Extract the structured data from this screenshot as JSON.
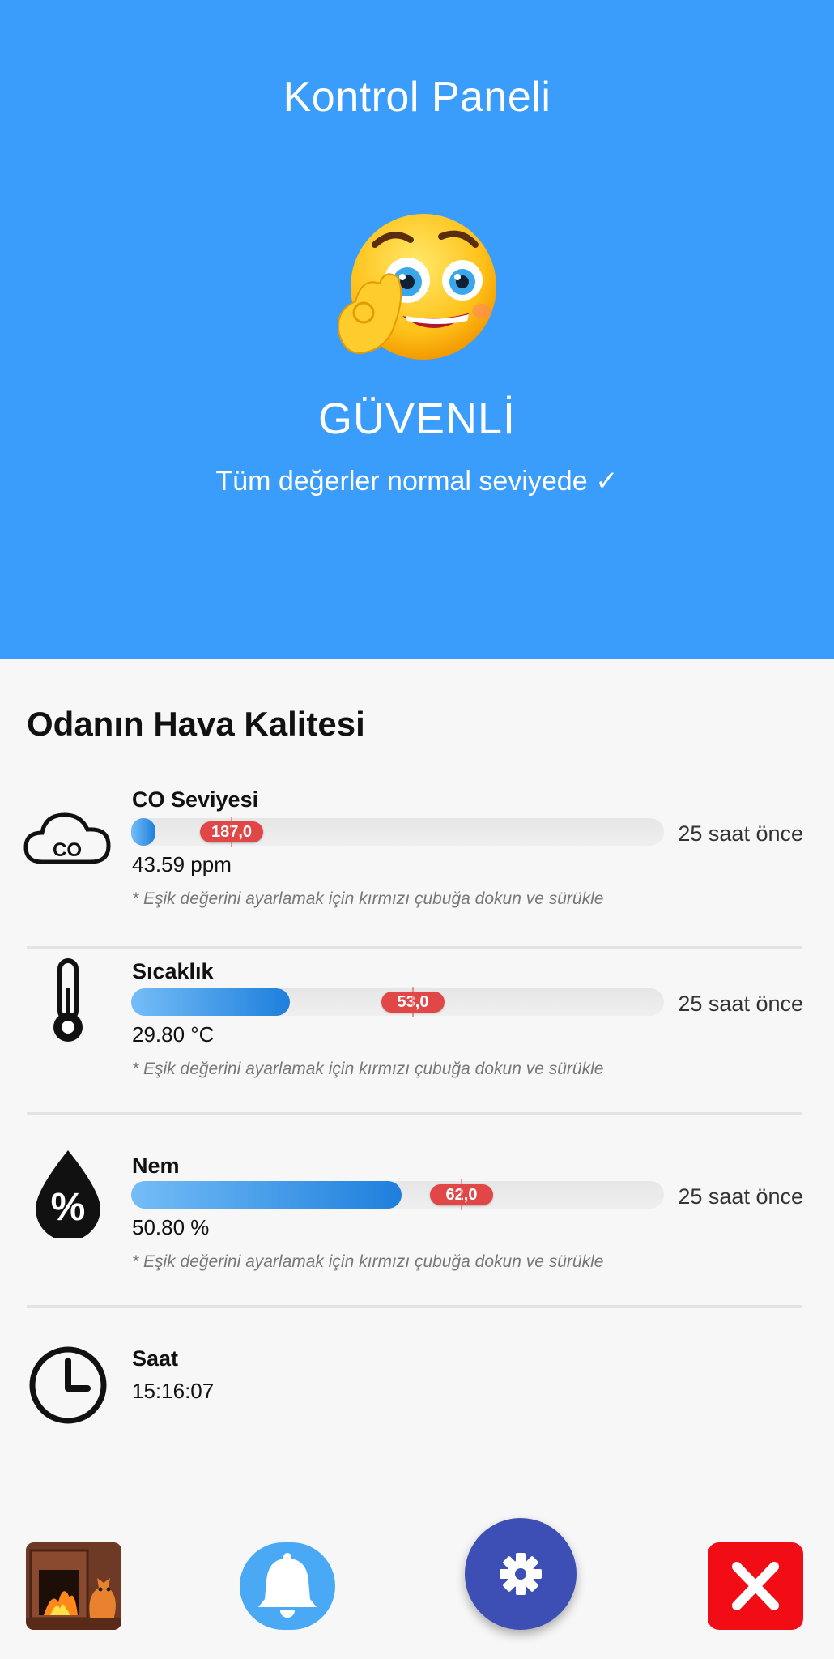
{
  "header": {
    "title": "Kontrol Paneli",
    "status": "GÜVENLİ",
    "subtitle": "Tüm değerler normal seviyede ✓",
    "mood_icon": "ok-hand-smiley-emoji",
    "background_color": "#3b9dfb"
  },
  "section_title": "Odanın Hava Kalitesi",
  "sensors": [
    {
      "name": "CO Seviyesi",
      "icon": "co-cloud-icon",
      "value": "43.59 ppm",
      "threshold_label": "187,0",
      "level_fraction": 0.04,
      "threshold_fraction": 0.19,
      "updated": "25 saat önce",
      "hint": "* Eşik değerini ayarlamak için kırmızı çubuğa dokun ve sürükle"
    },
    {
      "name": "Sıcaklık",
      "icon": "thermometer-icon",
      "value": "29.80 °C",
      "threshold_label": "53,0",
      "level_fraction": 0.3,
      "threshold_fraction": 0.53,
      "updated": "25 saat önce",
      "hint": "* Eşik değerini ayarlamak için kırmızı çubuğa dokun ve sürükle"
    },
    {
      "name": "Nem",
      "icon": "humidity-drop-icon",
      "value": "50.80 %",
      "threshold_label": "62,0",
      "level_fraction": 0.51,
      "threshold_fraction": 0.62,
      "updated": "25 saat önce",
      "hint": "* Eşik değerini ayarlamak için kırmızı çubuğa dokun ve sürükle"
    }
  ],
  "clock": {
    "name": "Saat",
    "value": "15:16:07",
    "icon": "clock-icon"
  },
  "bottom_nav": [
    {
      "icon": "fireplace-cat-icon",
      "color": "#7a3b22"
    },
    {
      "icon": "bell-icon",
      "color": "#4aa9f5"
    },
    {
      "icon": "gear-icon",
      "color": "#3d4fb4"
    },
    {
      "icon": "close-icon",
      "color": "#f20d16"
    }
  ]
}
